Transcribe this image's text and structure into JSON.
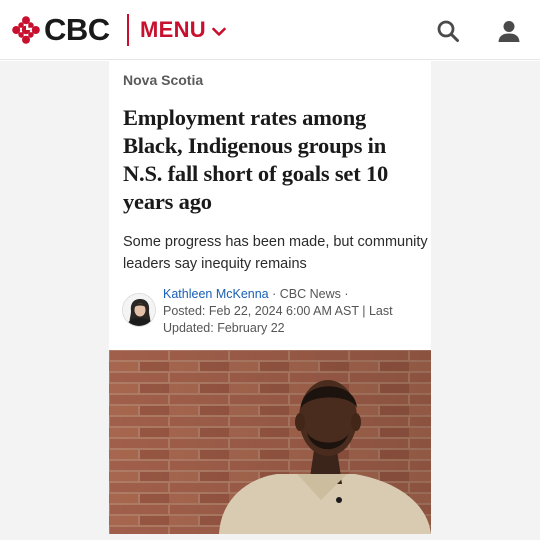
{
  "header": {
    "logo_text": "CBC",
    "menu_label": "MENU",
    "icons": [
      "cbc-gem-icon",
      "chevron-down-icon",
      "search-icon",
      "user-account-icon"
    ],
    "brand_color": "#c8102e"
  },
  "article": {
    "section": "Nova Scotia",
    "headline": "Employment rates among Black, Indigenous groups in N.S. fall short of goals set 10 years ago",
    "dek": "Some progress has been made, but community leaders say inequity remains",
    "byline": {
      "author": "Kathleen McKenna",
      "outlet": "CBC News",
      "posted_label": "Posted:",
      "posted": "Feb 22, 2024 6:00 AM AST",
      "updated_label": "Last Updated:",
      "updated": "February 22",
      "separator": "·",
      "pipe": "|"
    }
  },
  "colors": {
    "link": "#1a5fb4",
    "page_background": "#f3f3f3"
  }
}
